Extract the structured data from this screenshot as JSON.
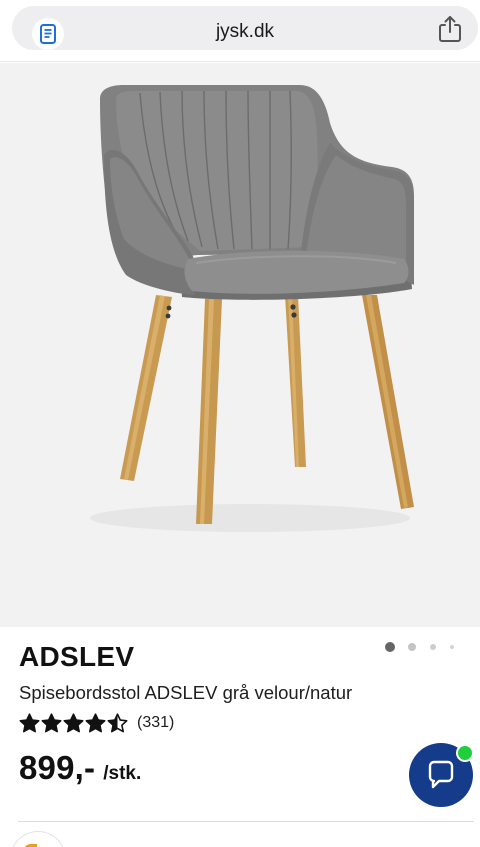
{
  "browser": {
    "url": "jysk.dk",
    "reader_icon": "reader-document-icon",
    "share_icon": "share-icon"
  },
  "gallery": {
    "image_name": "product-photo-chair",
    "slide_count": 4,
    "active_slide": 1
  },
  "product": {
    "name": "ADSLEV",
    "description": "Spisebordsstol ADSLEV grå velour/natur",
    "rating": 4.5,
    "rating_max": 5,
    "review_count": "(331)",
    "price": "899,-",
    "unit": "/stk."
  },
  "chat": {
    "icon": "chat-bubble-icon",
    "online_color": "#1fcf3c",
    "button_color": "#143c8a"
  },
  "colors": {
    "star": "#111111",
    "page_background": "#ffffff",
    "image_background": "#f2f2f2"
  }
}
